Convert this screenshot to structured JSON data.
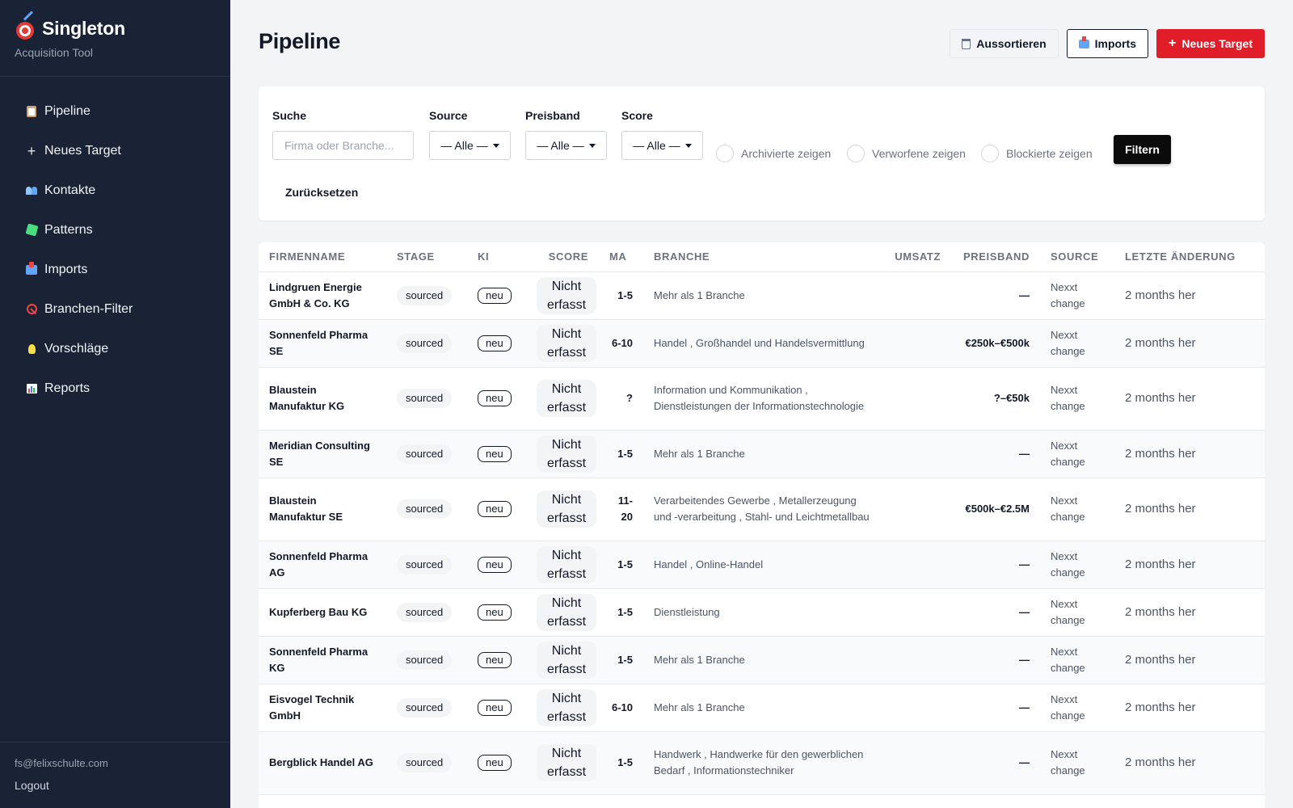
{
  "app": {
    "title": "Singleton",
    "subtitle": "Acquisition Tool"
  },
  "sidebar": {
    "items": [
      {
        "label": "Pipeline",
        "icon": "clipboard-icon"
      },
      {
        "label": "Neues Target",
        "icon": "plus-icon"
      },
      {
        "label": "Kontakte",
        "icon": "people-icon"
      },
      {
        "label": "Patterns",
        "icon": "puzzle-icon"
      },
      {
        "label": "Imports",
        "icon": "inbox-tray-icon"
      },
      {
        "label": "Branchen-Filter",
        "icon": "no-entry-icon"
      },
      {
        "label": "Vorschläge",
        "icon": "lightbulb-icon"
      },
      {
        "label": "Reports",
        "icon": "bar-chart-icon"
      }
    ],
    "footer": {
      "email": "fs@felixschulte.com",
      "logout": "Logout"
    }
  },
  "header": {
    "title": "Pipeline",
    "buttons": {
      "sort_out": "Aussortieren",
      "imports": "Imports",
      "new_target": "Neues Target",
      "new_target_prefix": "+"
    }
  },
  "filters": {
    "search": {
      "label": "Suche",
      "placeholder": "Firma oder Branche..."
    },
    "source": {
      "label": "Source",
      "value": "— Alle —"
    },
    "price_band": {
      "label": "Preisband",
      "value": "— Alle —"
    },
    "score": {
      "label": "Score",
      "value": "— Alle —"
    },
    "show_archived": "Archivierte zeigen",
    "show_rejected": "Verworfene zeigen",
    "show_blocked": "Blockierte zeigen",
    "filter_button": "Filtern",
    "reset_button": "Zurücksetzen"
  },
  "table": {
    "columns": [
      "FIRMENNAME",
      "STAGE",
      "KI",
      "SCORE",
      "MA",
      "BRANCHE",
      "UMSATZ",
      "PREISBAND",
      "SOURCE",
      "LETZTE ÄNDERUNG"
    ],
    "rows": [
      {
        "name": "Lindgruen Energie GmbH & Co. KG",
        "stage": "sourced",
        "ki": "neu",
        "score": "Nicht erfasst",
        "ma": "1-5",
        "branche": "Mehr als 1 Branche",
        "umsatz": "",
        "preisband": "—",
        "source": "Nexxt change",
        "updated": "2 months her"
      },
      {
        "name": "Sonnenfeld Pharma SE",
        "stage": "sourced",
        "ki": "neu",
        "score": "Nicht erfasst",
        "ma": "6-10",
        "branche": "Handel , Großhandel und Handelsvermittlung",
        "umsatz": "",
        "preisband": "€250k–€500k",
        "source": "Nexxt change",
        "updated": "2 months her"
      },
      {
        "name": "Blaustein Manufaktur KG",
        "stage": "sourced",
        "ki": "neu",
        "score": "Nicht erfasst",
        "ma": "?",
        "branche": "Information und Kommunikation , Dienstleistungen der Informationstechnologie",
        "umsatz": "",
        "preisband": "?–€50k",
        "source": "Nexxt change",
        "updated": "2 months her"
      },
      {
        "name": "Meridian Consulting SE",
        "stage": "sourced",
        "ki": "neu",
        "score": "Nicht erfasst",
        "ma": "1-5",
        "branche": "Mehr als 1 Branche",
        "umsatz": "",
        "preisband": "—",
        "source": "Nexxt change",
        "updated": "2 months her"
      },
      {
        "name": "Blaustein Manufaktur SE",
        "stage": "sourced",
        "ki": "neu",
        "score": "Nicht erfasst",
        "ma": "11-20",
        "branche": "Verarbeitendes Gewerbe , Metallerzeugung und -verarbeitung , Stahl- und Leichtmetallbau",
        "umsatz": "",
        "preisband": "€500k–€2.5M",
        "source": "Nexxt change",
        "updated": "2 months her"
      },
      {
        "name": "Sonnenfeld Pharma AG",
        "stage": "sourced",
        "ki": "neu",
        "score": "Nicht erfasst",
        "ma": "1-5",
        "branche": "Handel , Online-Handel",
        "umsatz": "",
        "preisband": "—",
        "source": "Nexxt change",
        "updated": "2 months her"
      },
      {
        "name": "Kupferberg Bau KG",
        "stage": "sourced",
        "ki": "neu",
        "score": "Nicht erfasst",
        "ma": "1-5",
        "branche": "Dienstleistung",
        "umsatz": "",
        "preisband": "—",
        "source": "Nexxt change",
        "updated": "2 months her"
      },
      {
        "name": "Sonnenfeld Pharma KG",
        "stage": "sourced",
        "ki": "neu",
        "score": "Nicht erfasst",
        "ma": "1-5",
        "branche": "Mehr als 1 Branche",
        "umsatz": "",
        "preisband": "—",
        "source": "Nexxt change",
        "updated": "2 months her"
      },
      {
        "name": "Eisvogel Technik GmbH",
        "stage": "sourced",
        "ki": "neu",
        "score": "Nicht erfasst",
        "ma": "6-10",
        "branche": "Mehr als 1 Branche",
        "umsatz": "",
        "preisband": "—",
        "source": "Nexxt change",
        "updated": "2 months her"
      },
      {
        "name": "Bergblick Handel AG",
        "stage": "sourced",
        "ki": "neu",
        "score": "Nicht erfasst",
        "ma": "1-5",
        "branche": "Handwerk , Handwerke für den gewerblichen Bedarf , Informationstechniker",
        "umsatz": "",
        "preisband": "—",
        "source": "Nexxt change",
        "updated": "2 months her"
      }
    ]
  },
  "colors": {
    "sidebar_bg": "#1a2236",
    "accent_red": "#e11d2a",
    "page_bg": "#f3f4f6"
  }
}
